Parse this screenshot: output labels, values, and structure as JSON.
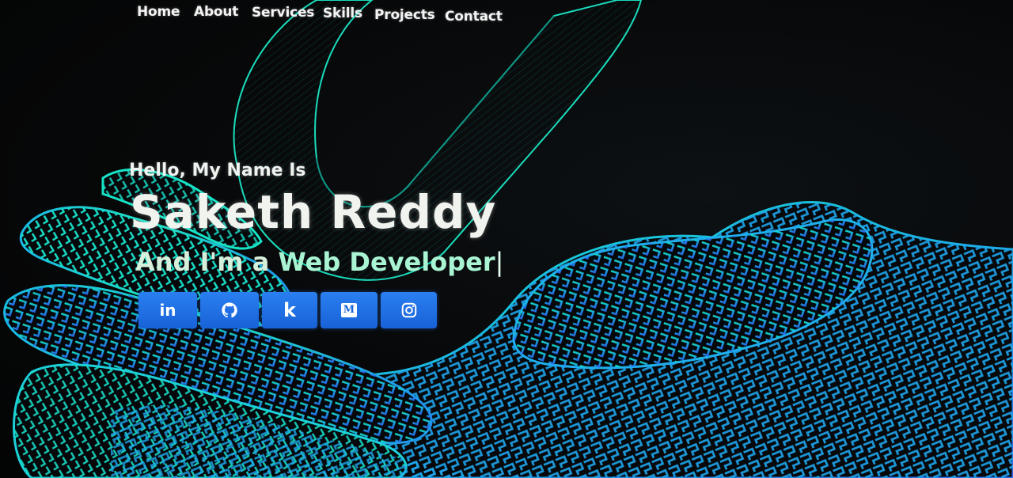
{
  "nav": {
    "links": [
      "Home",
      "About",
      "Services",
      "Skills",
      "Projects",
      "Contact"
    ]
  },
  "hero": {
    "greeting": "Hello, My Name Is",
    "name": "Saketh Reddy",
    "tagline_prefix": "And I'm a ",
    "tagline_role": "Web Developer",
    "cursor": "|"
  },
  "socials": [
    {
      "icon": "linkedin-icon",
      "glyph": "in"
    },
    {
      "icon": "github-icon"
    },
    {
      "icon": "kaggle-icon",
      "glyph": "k"
    },
    {
      "icon": "medium-icon",
      "glyph": "M"
    },
    {
      "icon": "instagram-icon"
    }
  ],
  "colors": {
    "background": "#050607",
    "art_teal": "#19e8c4",
    "art_blue": "#1e8cf2",
    "button_blue": "#1d6fe3",
    "text": "#f1f3ee"
  }
}
